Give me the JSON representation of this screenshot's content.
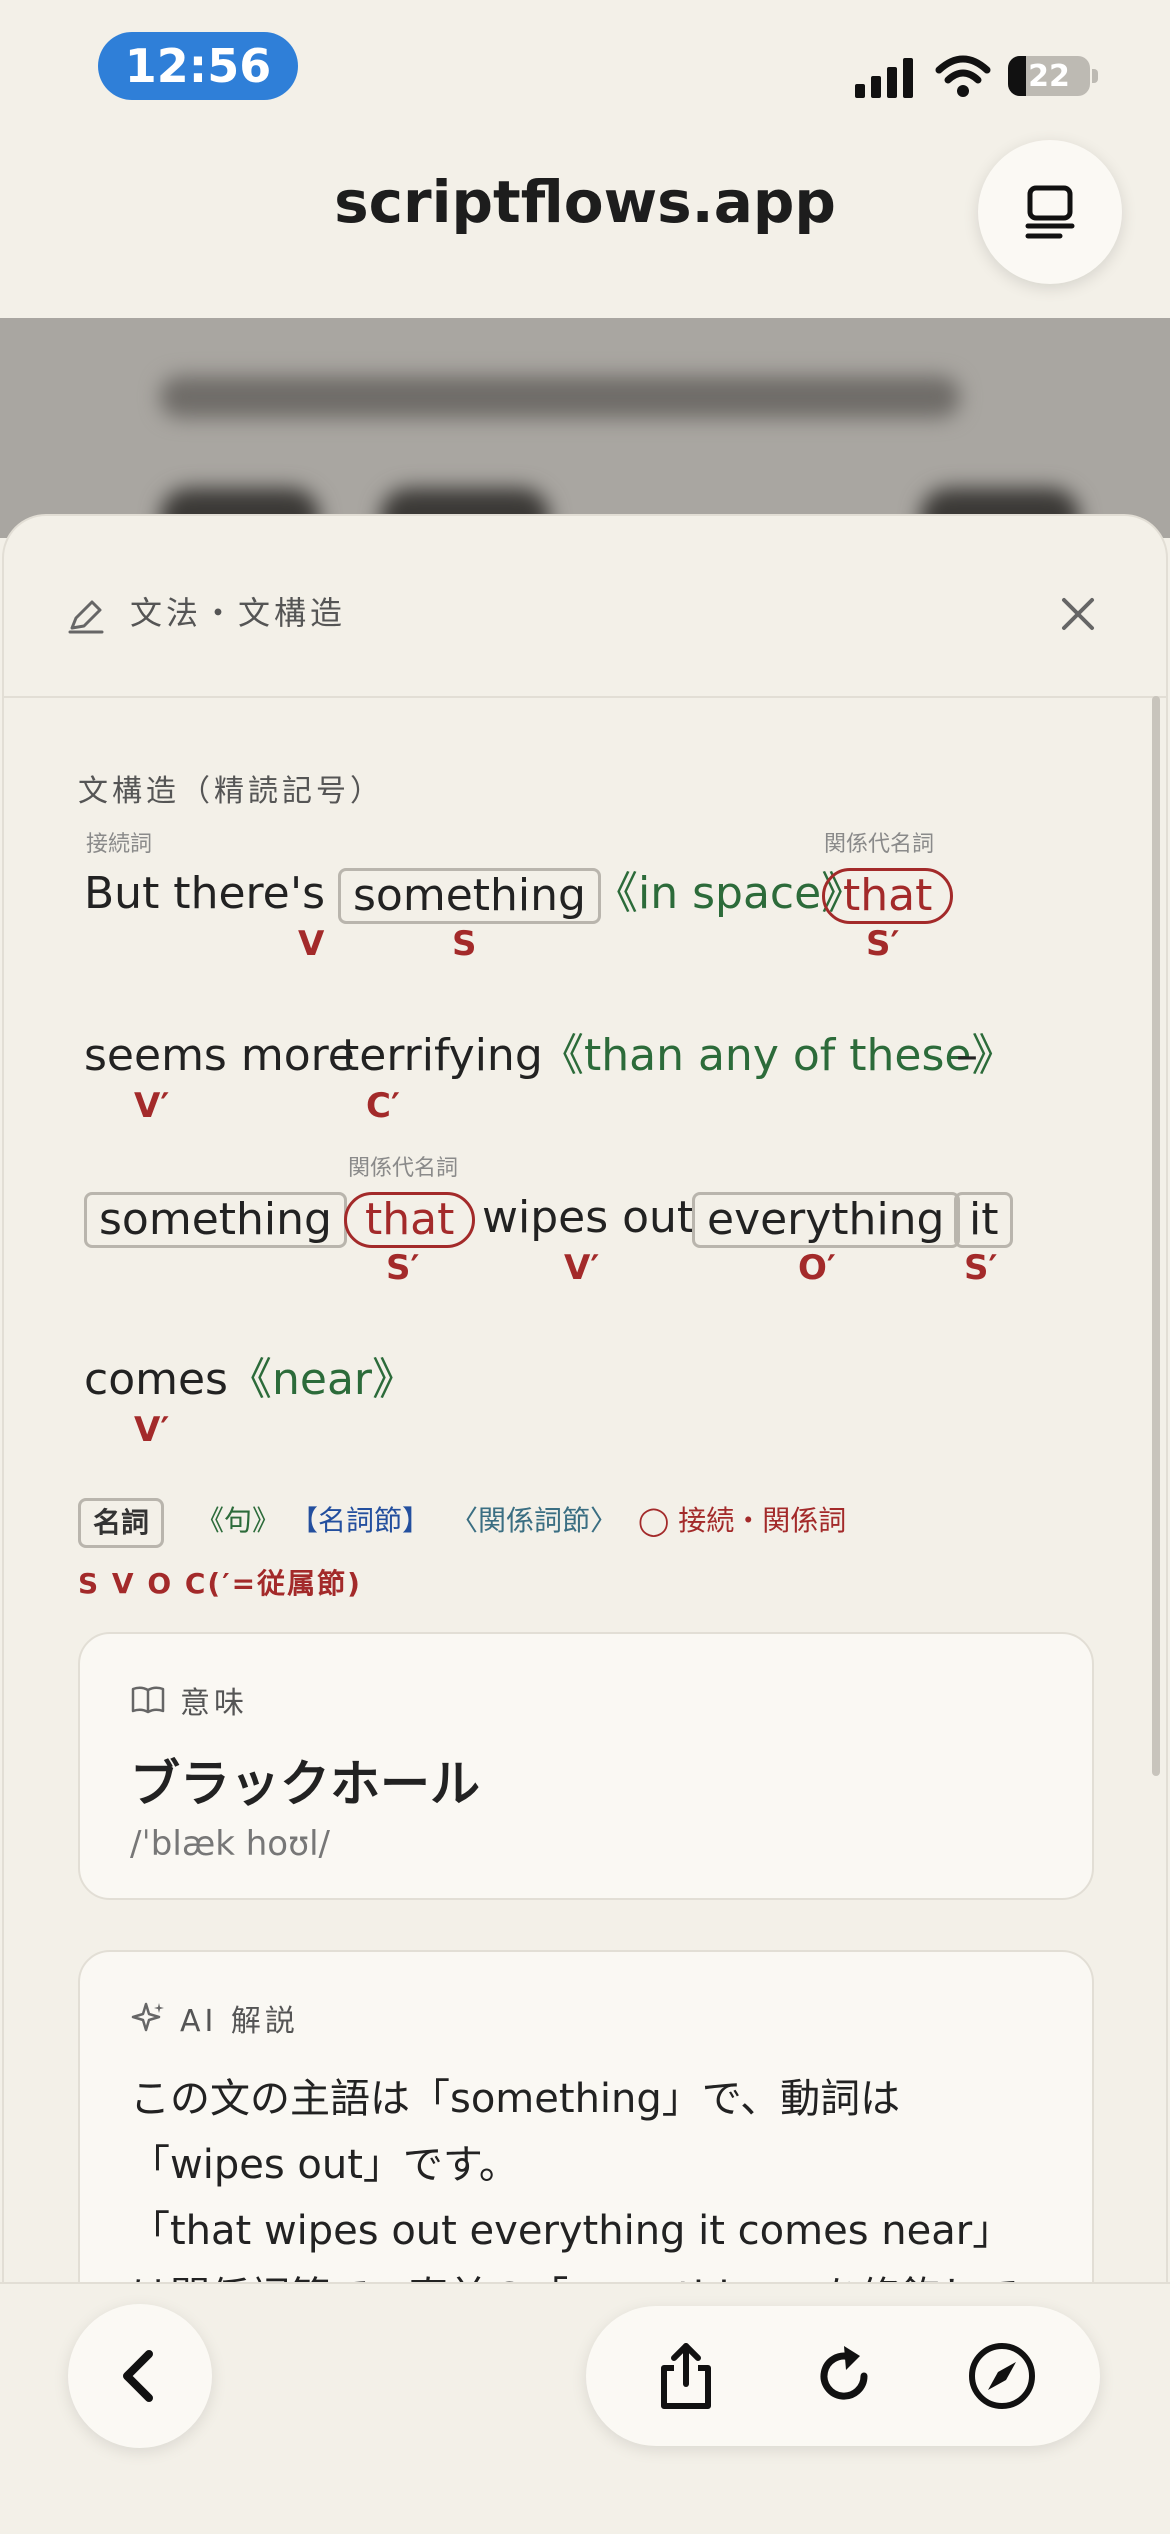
{
  "status": {
    "time": "12:56",
    "battery": "22"
  },
  "browser": {
    "url_title": "scriptflows.app"
  },
  "sheet": {
    "title": "文法・文構造",
    "section_label": "文構造（精読記号）",
    "lines": [
      [
        {
          "text": "But there"
        },
        {
          "text": "'s"
        },
        {
          "text": "something"
        },
        {
          "text": "《in space》"
        },
        {
          "text": "that"
        }
      ],
      [
        {
          "text": "seems more"
        },
        {
          "text": "terrifying"
        },
        {
          "text": "《than any of these》"
        },
        {
          "text": "–"
        }
      ],
      [
        {
          "text": "something"
        },
        {
          "text": "that"
        },
        {
          "text": "wipes out"
        },
        {
          "text": "everything"
        },
        {
          "text": "it"
        }
      ],
      [
        {
          "text": "comes"
        },
        {
          "text": "《near》"
        }
      ]
    ],
    "roles": {
      "l1_s": "V",
      "l1_something": "S",
      "l1_that": "S′",
      "l2_seems": "V′",
      "l2_terrifying": "C′",
      "l3_that": "S′",
      "l3_wipes": "V′",
      "l3_everything": "O′",
      "l3_it": "S′",
      "l4_comes": "V′"
    },
    "tags": {
      "conjunction": "接続詞",
      "relative_pronoun": "関係代名詞"
    },
    "legend": {
      "noun": "名詞",
      "phrase": "《句》",
      "noun_clause": "【名詞節】",
      "relative_clause": "〈関係詞節〉",
      "conj_relative": "◯ 接続・関係詞",
      "svoc": "S V O C(′=従属節)"
    },
    "meaning_card": {
      "header": "意味",
      "word": "ブラックホール",
      "ipa": "/ˈblæk hoʊl/"
    },
    "ai_card": {
      "header": "AI 解説",
      "line1": "この文の主語は「something」で、動詞は「wipes out」です。",
      "line2": "「that wipes out everything it comes near」は関係詞節で、直前の「something」を修飾しています。"
    }
  },
  "colors": {
    "accent_red": "#a32a2a",
    "phrase_green": "#2c6b3a",
    "clause_blue": "#234f9e",
    "time_pill": "#2f7fd8"
  },
  "icons": [
    "signal-icon",
    "wifi-icon",
    "battery-icon",
    "reader-mode-icon",
    "pen-icon",
    "close-icon",
    "book-icon",
    "sparkle-icon",
    "back-chevron-icon",
    "share-icon",
    "reload-icon",
    "compass-icon"
  ]
}
